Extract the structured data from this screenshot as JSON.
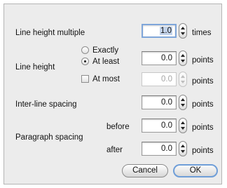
{
  "line_height_multiple": {
    "label": "Line height multiple",
    "value": "1.0",
    "unit": "times"
  },
  "line_height": {
    "label": "Line height",
    "options": {
      "exactly": "Exactly",
      "at_least": "At least",
      "at_most": "At most"
    },
    "selected": "At least",
    "value": "0.0",
    "unit": "points",
    "at_most_value": "0.0",
    "at_most_unit": "points"
  },
  "inter_line_spacing": {
    "label": "Inter-line spacing",
    "value": "0.0",
    "unit": "points"
  },
  "paragraph_spacing": {
    "label": "Paragraph spacing",
    "before_label": "before",
    "before_value": "0.0",
    "before_unit": "points",
    "after_label": "after",
    "after_value": "0.0",
    "after_unit": "points"
  },
  "buttons": {
    "cancel": "Cancel",
    "ok": "OK"
  },
  "colors": {
    "focus_ring": "#7fa6da",
    "selection": "#c3d3ea",
    "panel": "#ececec"
  }
}
